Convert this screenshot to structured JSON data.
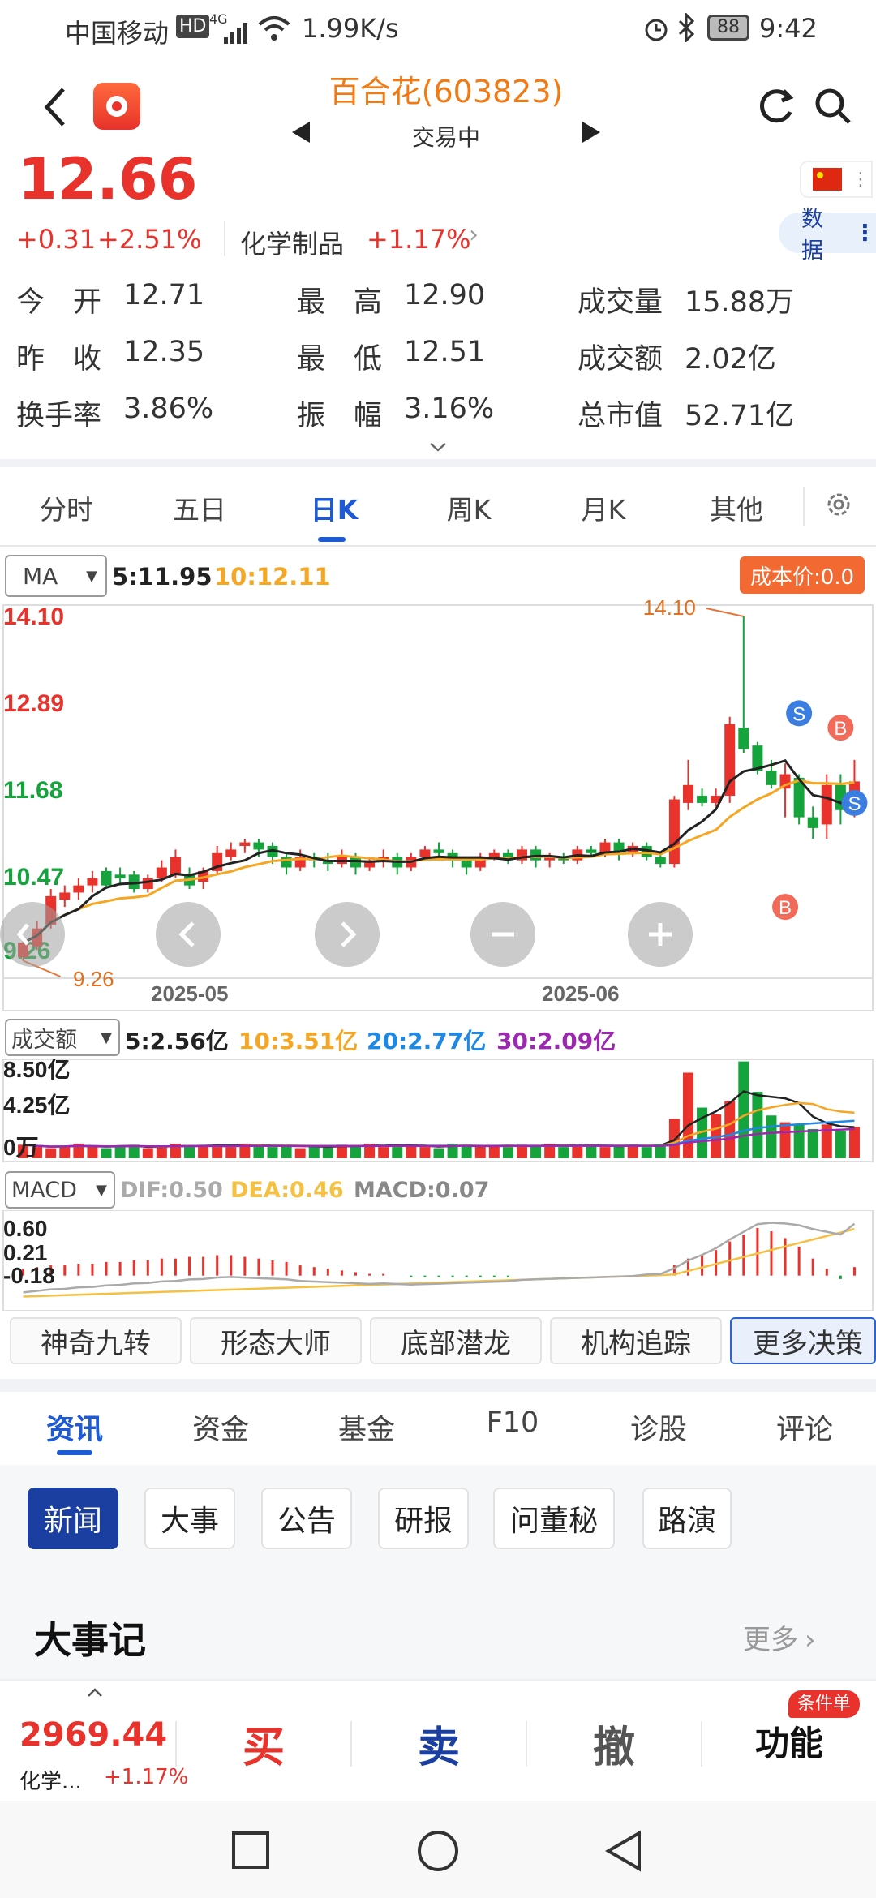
{
  "status_bar": {
    "carrier": "中国移动",
    "hd": "HD",
    "net": "4G",
    "speed": "1.99K/s",
    "battery": "88",
    "time": "9:42"
  },
  "header": {
    "title": "百合花(603823)",
    "status": "交易中"
  },
  "quote": {
    "price": "12.66",
    "change": "+0.31",
    "change_pct": "+2.51%",
    "sector": "化学制品",
    "sector_pct": "+1.17%",
    "data_btn": "数据"
  },
  "stats": [
    {
      "label": "今　开",
      "value": "12.71"
    },
    {
      "label": "最　高",
      "value": "12.90"
    },
    {
      "label": "成交量",
      "value": "15.88万"
    },
    {
      "label": "昨　收",
      "value": "12.35"
    },
    {
      "label": "最　低",
      "value": "12.51"
    },
    {
      "label": "成交额",
      "value": "2.02亿"
    },
    {
      "label": "换手率",
      "value": "3.86%"
    },
    {
      "label": "振　幅",
      "value": "3.16%"
    },
    {
      "label": "总市值",
      "value": "52.71亿"
    }
  ],
  "chart_tabs": [
    "分时",
    "五日",
    "日K",
    "周K",
    "月K",
    "其他"
  ],
  "ma_bar": {
    "select": "MA",
    "ma5": "5:11.95",
    "ma10": "10:12.11",
    "cost_btn": "成本价:0.0"
  },
  "chart_data": [
    {
      "type": "candlestick",
      "y_ticks": [
        "14.10",
        "12.89",
        "11.68",
        "10.47",
        "9.26"
      ],
      "ylim": [
        9.26,
        14.1
      ],
      "x_ticks": [
        "2025-05",
        "2025-06"
      ],
      "high_label": "14.10",
      "low_label": "9.26",
      "candles": [
        [
          9.35,
          9.55,
          9.3,
          9.6
        ],
        [
          9.5,
          9.75,
          9.45,
          9.85
        ],
        [
          9.8,
          10.2,
          9.75,
          10.3
        ],
        [
          10.15,
          10.25,
          10.05,
          10.35
        ],
        [
          10.25,
          10.35,
          10.15,
          10.45
        ],
        [
          10.35,
          10.45,
          10.25,
          10.55
        ],
        [
          10.55,
          10.35,
          10.3,
          10.6
        ],
        [
          10.5,
          10.45,
          10.35,
          10.6
        ],
        [
          10.5,
          10.3,
          10.25,
          10.55
        ],
        [
          10.3,
          10.45,
          10.25,
          10.5
        ],
        [
          10.45,
          10.6,
          10.4,
          10.7
        ],
        [
          10.5,
          10.75,
          10.45,
          10.85
        ],
        [
          10.5,
          10.35,
          10.3,
          10.6
        ],
        [
          10.4,
          10.55,
          10.3,
          10.6
        ],
        [
          10.55,
          10.8,
          10.5,
          10.9
        ],
        [
          10.75,
          10.85,
          10.7,
          10.95
        ],
        [
          10.9,
          10.95,
          10.8,
          11.0
        ],
        [
          10.95,
          10.85,
          10.75,
          11.0
        ],
        [
          10.9,
          10.75,
          10.65,
          10.95
        ],
        [
          10.75,
          10.6,
          10.5,
          10.8
        ],
        [
          10.6,
          10.75,
          10.55,
          10.85
        ],
        [
          10.75,
          10.7,
          10.6,
          10.8
        ],
        [
          10.7,
          10.65,
          10.55,
          10.8
        ],
        [
          10.65,
          10.75,
          10.6,
          10.85
        ],
        [
          10.75,
          10.6,
          10.5,
          10.8
        ],
        [
          10.6,
          10.7,
          10.55,
          10.75
        ],
        [
          10.7,
          10.75,
          10.6,
          10.85
        ],
        [
          10.75,
          10.6,
          10.5,
          10.8
        ],
        [
          10.6,
          10.75,
          10.55,
          10.8
        ],
        [
          10.75,
          10.85,
          10.7,
          10.9
        ],
        [
          10.85,
          10.8,
          10.7,
          10.95
        ],
        [
          10.8,
          10.7,
          10.6,
          10.85
        ],
        [
          10.7,
          10.6,
          10.5,
          10.75
        ],
        [
          10.6,
          10.75,
          10.55,
          10.8
        ],
        [
          10.75,
          10.8,
          10.7,
          10.85
        ],
        [
          10.8,
          10.7,
          10.65,
          10.85
        ],
        [
          10.7,
          10.85,
          10.65,
          10.9
        ],
        [
          10.85,
          10.7,
          10.6,
          10.9
        ],
        [
          10.7,
          10.75,
          10.6,
          10.8
        ],
        [
          10.75,
          10.7,
          10.65,
          10.8
        ],
        [
          10.7,
          10.85,
          10.65,
          10.9
        ],
        [
          10.85,
          10.8,
          10.75,
          10.9
        ],
        [
          10.8,
          10.95,
          10.75,
          11.0
        ],
        [
          10.95,
          10.8,
          10.7,
          11.0
        ],
        [
          10.8,
          10.9,
          10.75,
          10.95
        ],
        [
          10.9,
          10.75,
          10.7,
          10.95
        ],
        [
          10.75,
          10.65,
          10.6,
          10.8
        ],
        [
          10.65,
          11.55,
          10.6,
          11.6
        ],
        [
          11.5,
          11.75,
          11.4,
          12.1
        ],
        [
          11.6,
          11.5,
          11.45,
          11.7
        ],
        [
          11.5,
          11.6,
          11.45,
          11.7
        ],
        [
          11.6,
          12.6,
          11.5,
          12.7
        ],
        [
          12.55,
          12.25,
          12.2,
          14.1
        ],
        [
          12.3,
          11.95,
          11.9,
          12.35
        ],
        [
          11.95,
          11.75,
          11.7,
          12.1
        ],
        [
          11.7,
          11.9,
          11.3,
          12.05
        ],
        [
          11.85,
          11.3,
          11.2,
          11.9
        ],
        [
          11.3,
          11.15,
          11.0,
          11.45
        ],
        [
          11.2,
          11.75,
          11.0,
          11.9
        ],
        [
          11.75,
          11.4,
          11.2,
          11.9
        ],
        [
          11.4,
          11.8,
          11.3,
          12.1
        ]
      ],
      "markers": [
        "S",
        "B",
        "B",
        "S"
      ]
    },
    {
      "type": "bar",
      "select": "成交额",
      "legend": [
        "5:2.56亿",
        "10:3.51亿",
        "20:2.77亿",
        "30:2.09亿"
      ],
      "y_ticks": [
        "8.50亿",
        "4.25亿",
        "0万"
      ],
      "ylim": [
        0,
        8.5
      ],
      "values": [
        1.2,
        1.0,
        0.9,
        1.1,
        1.3,
        1.0,
        0.9,
        1.1,
        1.2,
        0.9,
        1.0,
        1.3,
        1.1,
        1.2,
        1.1,
        1.0,
        1.3,
        1.2,
        1.0,
        1.1,
        0.9,
        1.1,
        1.0,
        1.2,
        1.1,
        1.3,
        1.0,
        1.2,
        1.1,
        1.0,
        0.9,
        1.3,
        1.2,
        1.0,
        1.1,
        1.0,
        1.2,
        1.1,
        1.3,
        1.0,
        1.1,
        1.2,
        1.0,
        1.1,
        1.2,
        1.0,
        1.3,
        3.5,
        7.6,
        4.5,
        3.9,
        5.1,
        8.6,
        5.9,
        3.8,
        3.2,
        3.0,
        2.6,
        3.0,
        2.4,
        2.8
      ]
    },
    {
      "type": "bar",
      "select": "MACD",
      "legend": [
        "DIF:0.50",
        "DEA:0.46",
        "MACD:0.07"
      ],
      "y_ticks": [
        "0.60",
        "0.21",
        "-0.18"
      ],
      "ylim": [
        -0.18,
        0.6
      ],
      "macd": [
        0.04,
        0.05,
        0.06,
        0.06,
        0.07,
        0.07,
        0.08,
        0.08,
        0.09,
        0.09,
        0.1,
        0.1,
        0.11,
        0.11,
        0.12,
        0.12,
        0.11,
        0.1,
        0.09,
        0.08,
        0.06,
        0.05,
        0.04,
        0.03,
        0.02,
        0.01,
        0.01,
        0.0,
        -0.01,
        -0.01,
        -0.01,
        -0.01,
        -0.01,
        -0.01,
        -0.01,
        -0.01,
        0.0,
        0.0,
        0.0,
        0.0,
        0.0,
        0.0,
        0.0,
        0.0,
        0.0,
        0.01,
        0.01,
        0.06,
        0.1,
        0.12,
        0.15,
        0.2,
        0.24,
        0.28,
        0.26,
        0.22,
        0.17,
        0.1,
        0.04,
        -0.02,
        0.05
      ]
    }
  ],
  "nav_controls": [
    "left",
    "right",
    "zoom-out",
    "zoom-in"
  ],
  "tools": [
    "神奇九转",
    "形态大师",
    "底部潜龙",
    "机构追踪",
    "更多决策"
  ],
  "info_tabs": [
    "资讯",
    "资金",
    "基金",
    "F10",
    "诊股",
    "评论"
  ],
  "news_chips": [
    "新闻",
    "大事",
    "公告",
    "研报",
    "问董秘",
    "路演"
  ],
  "events": {
    "title": "大事记",
    "more": "更多"
  },
  "bottom_bar": {
    "index_value": "2969.44",
    "index_name": "化学...",
    "index_pct": "+1.17%",
    "buy": "买",
    "sell": "卖",
    "cancel": "撤",
    "func": "功能",
    "badge": "条件单"
  }
}
